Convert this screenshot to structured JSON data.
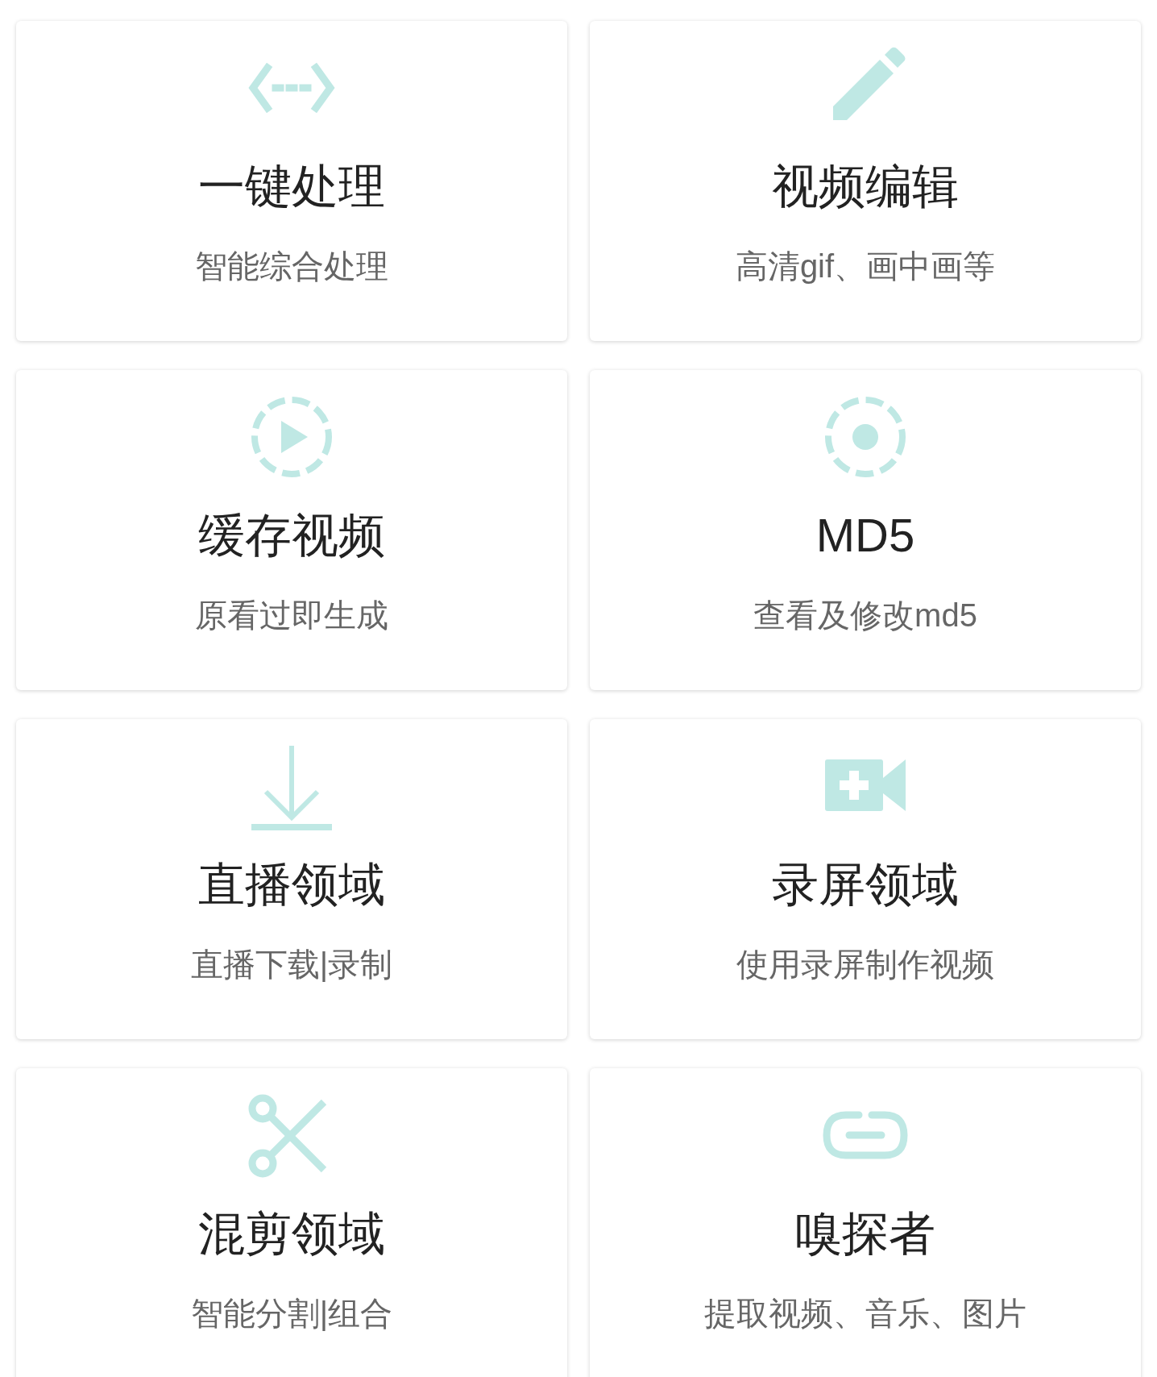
{
  "cards": [
    {
      "title": "一键处理",
      "subtitle": "智能综合处理"
    },
    {
      "title": "视频编辑",
      "subtitle": "高清gif、画中画等"
    },
    {
      "title": "缓存视频",
      "subtitle": "原看过即生成"
    },
    {
      "title": "MD5",
      "subtitle": "查看及修改md5"
    },
    {
      "title": "直播领域",
      "subtitle": "直播下载|录制"
    },
    {
      "title": "录屏领域",
      "subtitle": "使用录屏制作视频"
    },
    {
      "title": "混剪领域",
      "subtitle": "智能分割|组合"
    },
    {
      "title": "嗅探者",
      "subtitle": "提取视频、音乐、图片"
    }
  ]
}
